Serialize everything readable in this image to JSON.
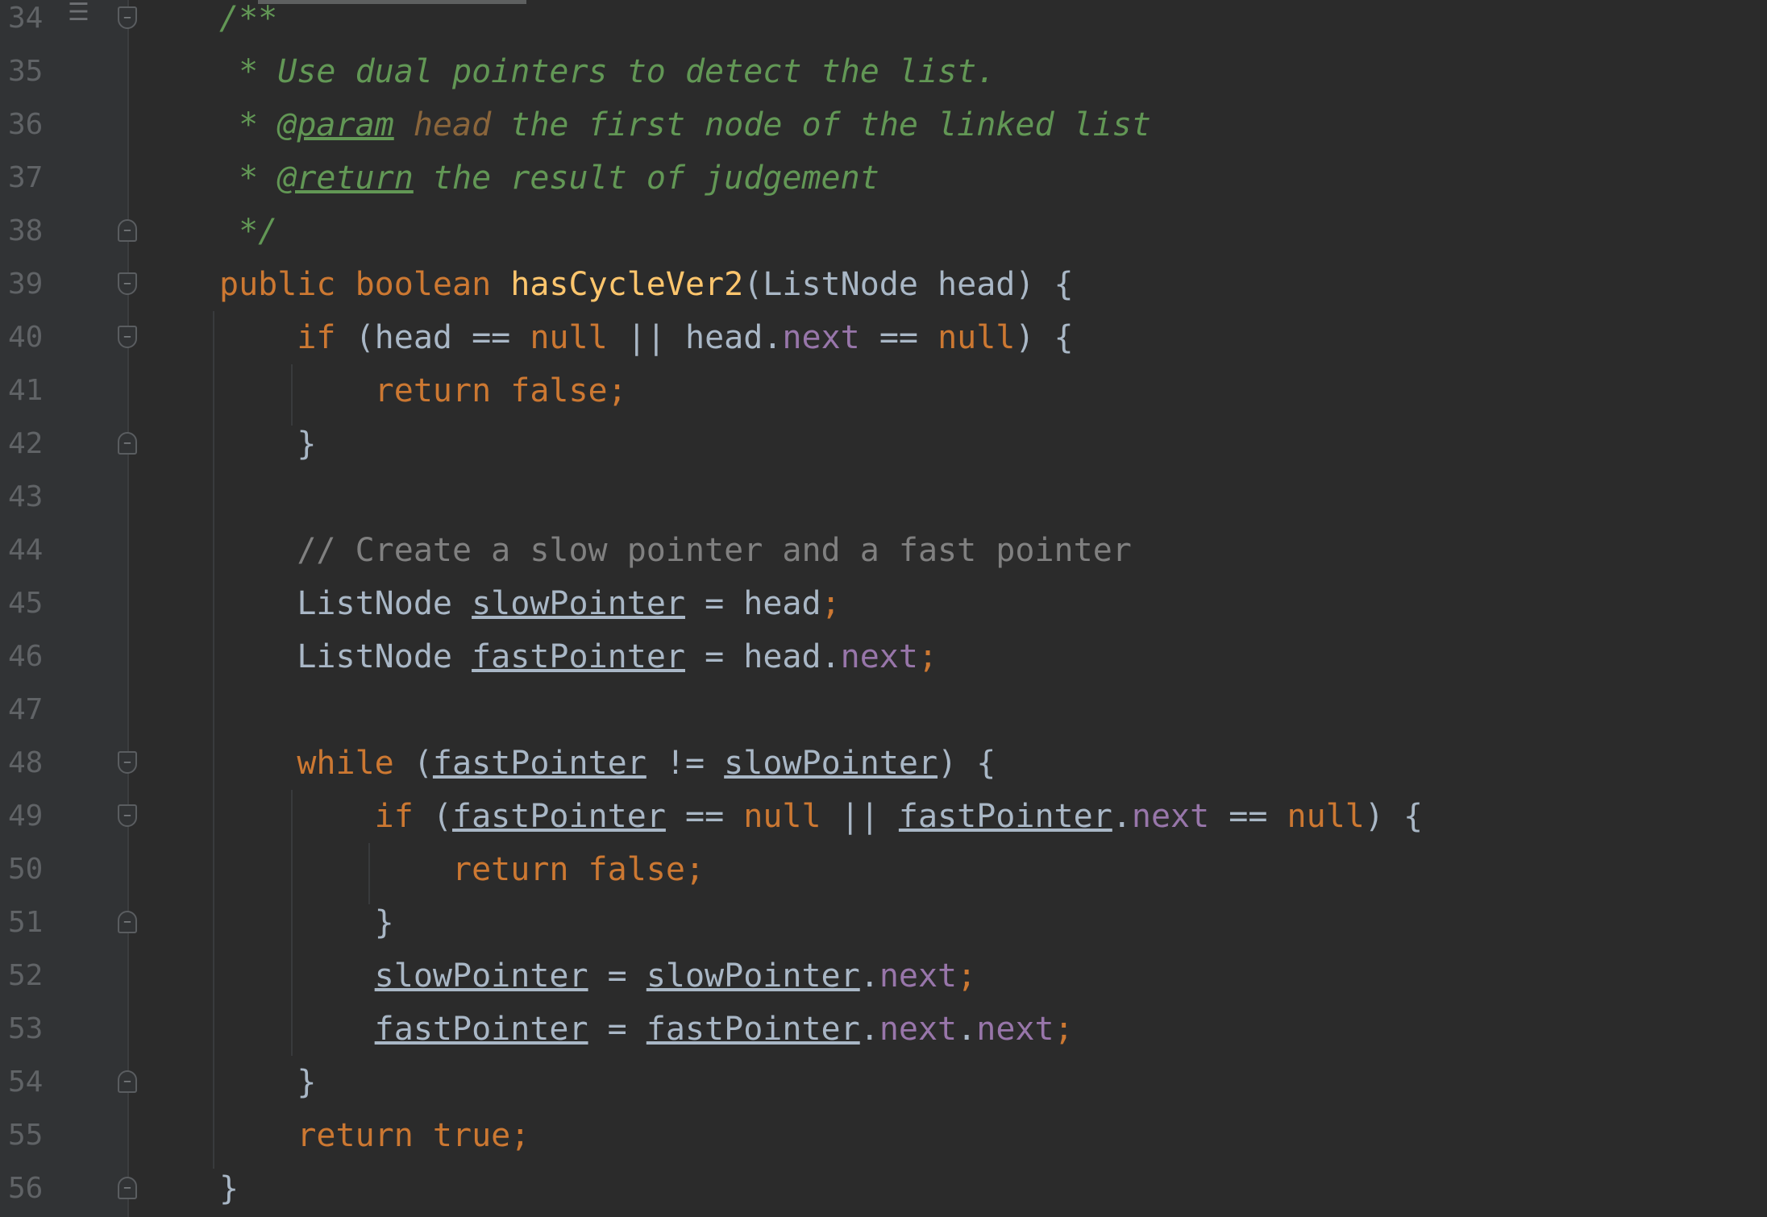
{
  "editor": {
    "lines": [
      {
        "n": "34",
        "tokens": [
          {
            "t": "/**",
            "c": "doc"
          }
        ]
      },
      {
        "n": "35",
        "tokens": [
          {
            "t": " * Use dual pointers to detect the list.",
            "c": "doc"
          }
        ]
      },
      {
        "n": "36",
        "tokens": [
          {
            "t": " * ",
            "c": "doc"
          },
          {
            "t": "@param",
            "c": "doctag"
          },
          {
            "t": " ",
            "c": "doc"
          },
          {
            "t": "head",
            "c": "docparam"
          },
          {
            "t": " the first node of the linked list",
            "c": "doc"
          }
        ]
      },
      {
        "n": "37",
        "tokens": [
          {
            "t": " * ",
            "c": "doc"
          },
          {
            "t": "@return",
            "c": "doctag"
          },
          {
            "t": " the result of judgement",
            "c": "doc"
          }
        ]
      },
      {
        "n": "38",
        "tokens": [
          {
            "t": " */",
            "c": "doc"
          }
        ]
      },
      {
        "n": "39",
        "tokens": [
          {
            "t": "public boolean ",
            "c": "kw"
          },
          {
            "t": "hasCycleVer2",
            "c": "fn"
          },
          {
            "t": "(ListNode head) {",
            "c": "plain"
          }
        ]
      },
      {
        "n": "40",
        "tokens": [
          {
            "t": "    ",
            "c": "plain"
          },
          {
            "t": "if",
            "c": "kw"
          },
          {
            "t": " (head == ",
            "c": "plain"
          },
          {
            "t": "null",
            "c": "kw"
          },
          {
            "t": " || head.",
            "c": "plain"
          },
          {
            "t": "next",
            "c": "field"
          },
          {
            "t": " == ",
            "c": "plain"
          },
          {
            "t": "null",
            "c": "kw"
          },
          {
            "t": ") {",
            "c": "plain"
          }
        ]
      },
      {
        "n": "41",
        "tokens": [
          {
            "t": "        ",
            "c": "plain"
          },
          {
            "t": "return false;",
            "c": "kw"
          }
        ]
      },
      {
        "n": "42",
        "tokens": [
          {
            "t": "    }",
            "c": "plain"
          }
        ]
      },
      {
        "n": "43",
        "tokens": []
      },
      {
        "n": "44",
        "tokens": [
          {
            "t": "    ",
            "c": "plain"
          },
          {
            "t": "// Create a slow pointer and a fast pointer",
            "c": "cmt"
          }
        ]
      },
      {
        "n": "45",
        "tokens": [
          {
            "t": "    ListNode ",
            "c": "plain"
          },
          {
            "t": "slowPointer",
            "c": "var"
          },
          {
            "t": " = head",
            "c": "plain"
          },
          {
            "t": ";",
            "c": "semi"
          }
        ]
      },
      {
        "n": "46",
        "tokens": [
          {
            "t": "    ListNode ",
            "c": "plain"
          },
          {
            "t": "fastPointer",
            "c": "var"
          },
          {
            "t": " = head.",
            "c": "plain"
          },
          {
            "t": "next",
            "c": "field"
          },
          {
            "t": ";",
            "c": "semi"
          }
        ]
      },
      {
        "n": "47",
        "tokens": []
      },
      {
        "n": "48",
        "tokens": [
          {
            "t": "    ",
            "c": "plain"
          },
          {
            "t": "while",
            "c": "kw"
          },
          {
            "t": " (",
            "c": "plain"
          },
          {
            "t": "fastPointer",
            "c": "var"
          },
          {
            "t": " != ",
            "c": "plain"
          },
          {
            "t": "slowPointer",
            "c": "var"
          },
          {
            "t": ") {",
            "c": "plain"
          }
        ]
      },
      {
        "n": "49",
        "tokens": [
          {
            "t": "        ",
            "c": "plain"
          },
          {
            "t": "if",
            "c": "kw"
          },
          {
            "t": " (",
            "c": "plain"
          },
          {
            "t": "fastPointer",
            "c": "var"
          },
          {
            "t": " == ",
            "c": "plain"
          },
          {
            "t": "null",
            "c": "kw"
          },
          {
            "t": " || ",
            "c": "plain"
          },
          {
            "t": "fastPointer",
            "c": "var"
          },
          {
            "t": ".",
            "c": "plain"
          },
          {
            "t": "next",
            "c": "field"
          },
          {
            "t": " == ",
            "c": "plain"
          },
          {
            "t": "null",
            "c": "kw"
          },
          {
            "t": ") {",
            "c": "plain"
          }
        ]
      },
      {
        "n": "50",
        "tokens": [
          {
            "t": "            ",
            "c": "plain"
          },
          {
            "t": "return false;",
            "c": "kw"
          }
        ]
      },
      {
        "n": "51",
        "tokens": [
          {
            "t": "        }",
            "c": "plain"
          }
        ]
      },
      {
        "n": "52",
        "tokens": [
          {
            "t": "        ",
            "c": "plain"
          },
          {
            "t": "slowPointer",
            "c": "var"
          },
          {
            "t": " = ",
            "c": "plain"
          },
          {
            "t": "slowPointer",
            "c": "var"
          },
          {
            "t": ".",
            "c": "plain"
          },
          {
            "t": "next",
            "c": "field"
          },
          {
            "t": ";",
            "c": "semi"
          }
        ]
      },
      {
        "n": "53",
        "tokens": [
          {
            "t": "        ",
            "c": "plain"
          },
          {
            "t": "fastPointer",
            "c": "var"
          },
          {
            "t": " = ",
            "c": "plain"
          },
          {
            "t": "fastPointer",
            "c": "var"
          },
          {
            "t": ".",
            "c": "plain"
          },
          {
            "t": "next",
            "c": "field"
          },
          {
            "t": ".",
            "c": "plain"
          },
          {
            "t": "next",
            "c": "field"
          },
          {
            "t": ";",
            "c": "semi"
          }
        ]
      },
      {
        "n": "54",
        "tokens": [
          {
            "t": "    }",
            "c": "plain"
          }
        ]
      },
      {
        "n": "55",
        "tokens": [
          {
            "t": "    ",
            "c": "plain"
          },
          {
            "t": "return true;",
            "c": "kw"
          }
        ]
      },
      {
        "n": "56",
        "tokens": [
          {
            "t": "}",
            "c": "plain"
          }
        ]
      }
    ],
    "folds": {
      "34": "open",
      "38": "close",
      "39": "open",
      "40": "open",
      "42": "close",
      "48": "open",
      "49": "open",
      "51": "close",
      "54": "close",
      "56": "close"
    },
    "icons": {
      "line_34": "structure-lines-icon"
    }
  }
}
